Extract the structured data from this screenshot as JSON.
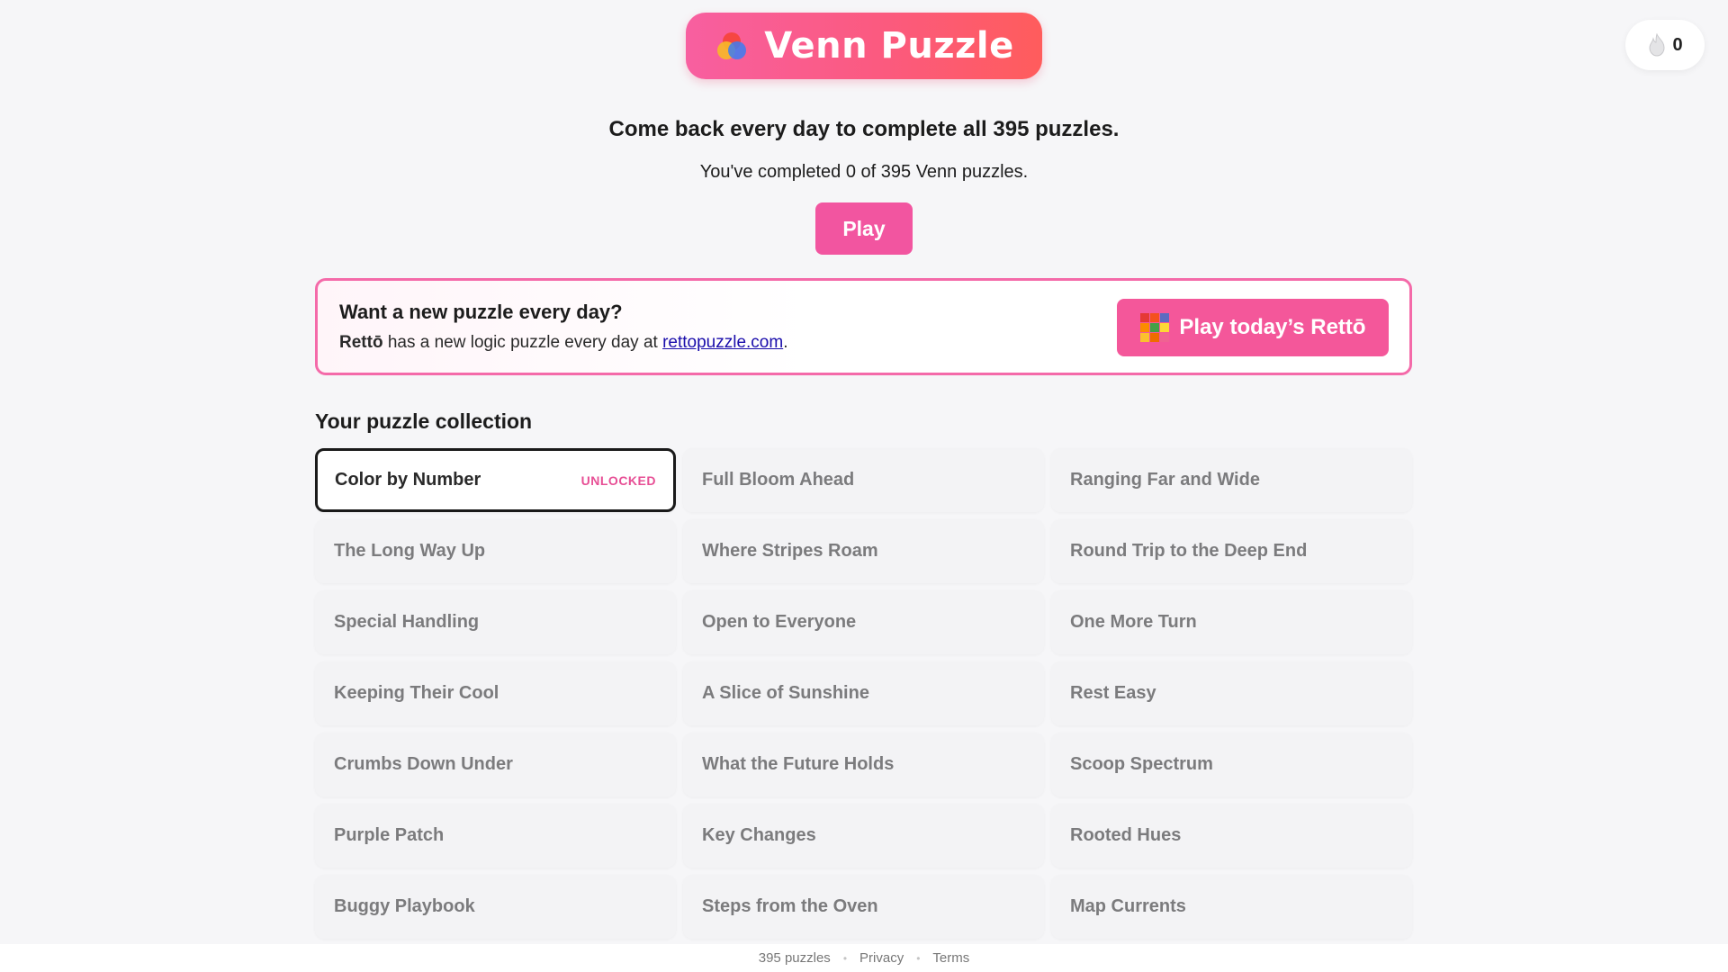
{
  "header": {
    "logo_text": "Venn Puzzle",
    "logo_icon": "venn-circles-icon",
    "streak_icon": "flame-icon",
    "streak_count": "0"
  },
  "hero": {
    "headline": "Come back every day to complete all 395 puzzles.",
    "progress_text": "You've completed 0 of 395 Venn puzzles.",
    "play_label": "Play"
  },
  "promo": {
    "title": "Want a new puzzle every day?",
    "brand": "Rettō",
    "text_middle": " has a new logic puzzle every day at ",
    "link_text": "rettopuzzle.com",
    "text_end": ".",
    "button_label": "Play today’s Rettō",
    "button_icon": "retto-grid-icon"
  },
  "collection": {
    "title": "Your puzzle collection",
    "items": [
      {
        "title": "Color by Number",
        "badge": "UNLOCKED"
      },
      {
        "title": "Full Bloom Ahead",
        "badge": ""
      },
      {
        "title": "Ranging Far and Wide",
        "badge": ""
      },
      {
        "title": "The Long Way Up",
        "badge": ""
      },
      {
        "title": "Where Stripes Roam",
        "badge": ""
      },
      {
        "title": "Round Trip to the Deep End",
        "badge": ""
      },
      {
        "title": "Special Handling",
        "badge": ""
      },
      {
        "title": "Open to Everyone",
        "badge": ""
      },
      {
        "title": "One More Turn",
        "badge": ""
      },
      {
        "title": "Keeping Their Cool",
        "badge": ""
      },
      {
        "title": "A Slice of Sunshine",
        "badge": ""
      },
      {
        "title": "Rest Easy",
        "badge": ""
      },
      {
        "title": "Crumbs Down Under",
        "badge": ""
      },
      {
        "title": "What the Future Holds",
        "badge": ""
      },
      {
        "title": "Scoop Spectrum",
        "badge": ""
      },
      {
        "title": "Purple Patch",
        "badge": ""
      },
      {
        "title": "Key Changes",
        "badge": ""
      },
      {
        "title": "Rooted Hues",
        "badge": ""
      },
      {
        "title": "Buggy Playbook",
        "badge": ""
      },
      {
        "title": "Steps from the Oven",
        "badge": ""
      },
      {
        "title": "Map Currents",
        "badge": ""
      }
    ]
  },
  "footer": {
    "count_text": "395 puzzles",
    "privacy": "Privacy",
    "terms": "Terms"
  },
  "colors": {
    "accent_pink": "#f255a0",
    "logo_gradient_start": "#f85fa0",
    "logo_gradient_end": "#ff5c5c",
    "link_blue": "#1a0dab",
    "badge_pink": "#e74f95"
  }
}
